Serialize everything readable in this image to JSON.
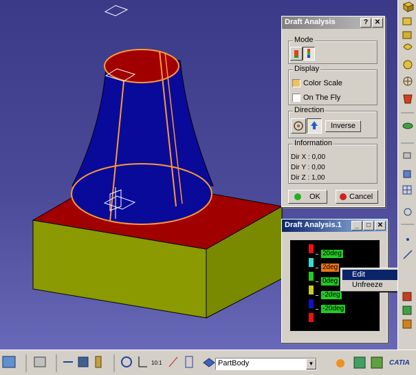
{
  "draft_window": {
    "title": "Draft Analysis",
    "help_button": "?",
    "close_button": "✕",
    "mode_label": "Mode",
    "display_label": "Display",
    "color_scale_label": "Color Scale",
    "color_scale_checked": true,
    "on_the_fly_label": "On The Fly",
    "on_the_fly_checked": false,
    "direction_label": "Direction",
    "inverse_button": "Inverse",
    "information_label": "Information",
    "dir_x": "Dir X : 0,00",
    "dir_y": "Dir Y : 0,00",
    "dir_z": "Dir Z : 1,00",
    "ok_button": "OK",
    "cancel_button": "Cancel"
  },
  "scale_window": {
    "title": "Draft Analysis.1",
    "minimize": "_",
    "maximize": "□",
    "close": "✕",
    "entries": [
      {
        "label": "20deg",
        "color": "#ee1111"
      },
      {
        "label": "2deg",
        "color": "#33dddd",
        "highlighted": true
      },
      {
        "label": "0deg",
        "color": "#22cc22"
      },
      {
        "label": "-2deg",
        "color": "#cccc22"
      },
      {
        "label": "-20deg",
        "color": "#1111cc"
      }
    ]
  },
  "context_menu": {
    "items": [
      {
        "label": "Edit",
        "selected": true
      },
      {
        "label": "Unfreeze",
        "selected": false
      }
    ]
  },
  "bottom_toolbar": {
    "part_body_combo": "PartBody",
    "brand": "CATIA"
  },
  "colors": {
    "model_red": "#a00000",
    "model_blue": "#0a0a9a",
    "model_olive": "#8a9a00",
    "edge_orange": "#ff9933",
    "background": "#3c3c8c"
  }
}
